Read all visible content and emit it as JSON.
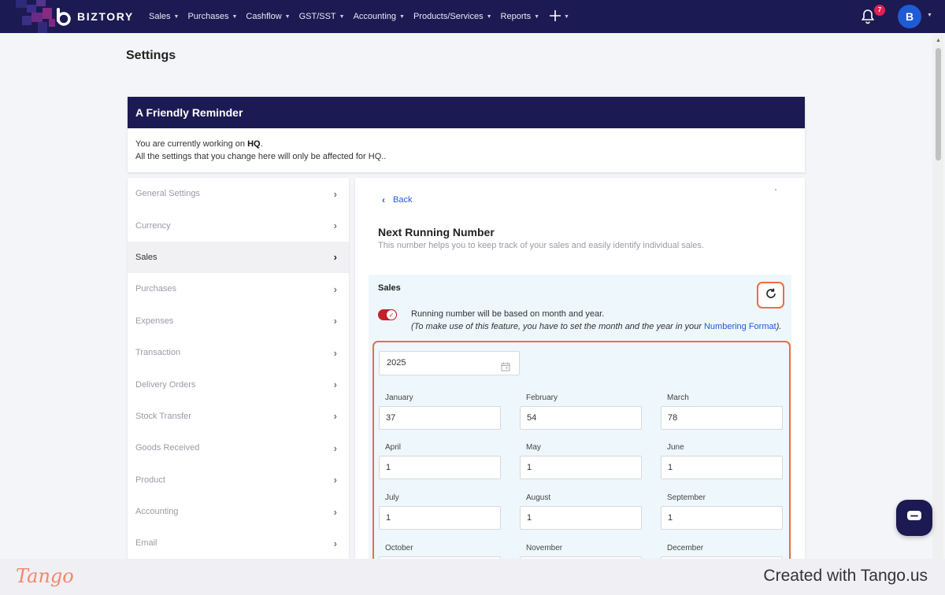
{
  "nav": {
    "brand": "BIZTORY",
    "menu": [
      {
        "label": "Sales"
      },
      {
        "label": "Purchases"
      },
      {
        "label": "Cashflow"
      },
      {
        "label": "GST/SST"
      },
      {
        "label": "Accounting"
      },
      {
        "label": "Products/Services"
      },
      {
        "label": "Reports"
      }
    ],
    "notification_count": "7",
    "avatar_initial": "B"
  },
  "page": {
    "title": "Settings"
  },
  "reminder": {
    "title": "A Friendly Reminder",
    "line1_prefix": "You are currently working on ",
    "line1_bold": "HQ",
    "line1_suffix": ".",
    "line2": "All the settings that you change here will only be affected for HQ.."
  },
  "sidebar": {
    "items": [
      {
        "label": "General Settings"
      },
      {
        "label": "Currency"
      },
      {
        "label": "Sales"
      },
      {
        "label": "Purchases"
      },
      {
        "label": "Expenses"
      },
      {
        "label": "Transaction"
      },
      {
        "label": "Delivery Orders"
      },
      {
        "label": "Stock Transfer"
      },
      {
        "label": "Goods Received"
      },
      {
        "label": "Product"
      },
      {
        "label": "Accounting"
      },
      {
        "label": "Email"
      }
    ],
    "active": "Sales"
  },
  "main": {
    "back_label": "Back",
    "title": "Next Running Number",
    "description": "This number helps you to keep track of your sales and easily identify individual sales.",
    "section": {
      "label": "Sales",
      "toggle_on": true,
      "toggle_text": "Running number will be based on month and year.",
      "note_prefix": "(To make use of this feature, you have to set the month and the year in your ",
      "note_link": "Numbering Format",
      "note_suffix": ").",
      "year": "2025",
      "months": [
        {
          "label": "January",
          "value": "37"
        },
        {
          "label": "February",
          "value": "54"
        },
        {
          "label": "March",
          "value": "78"
        },
        {
          "label": "April",
          "value": "1"
        },
        {
          "label": "May",
          "value": "1"
        },
        {
          "label": "June",
          "value": "1"
        },
        {
          "label": "July",
          "value": "1"
        },
        {
          "label": "August",
          "value": "1"
        },
        {
          "label": "September",
          "value": "1"
        },
        {
          "label": "October",
          "value": ""
        },
        {
          "label": "November",
          "value": ""
        },
        {
          "label": "December",
          "value": ""
        }
      ]
    }
  },
  "footer": {
    "logo": "Tango",
    "text": "Created with Tango.us"
  },
  "colors": {
    "nav_bg": "#1c1a52",
    "accent_blue": "#1f5bd6",
    "highlight_orange": "#f26c3f",
    "toggle_red": "#c3202a",
    "badge_red": "#e3204e"
  }
}
